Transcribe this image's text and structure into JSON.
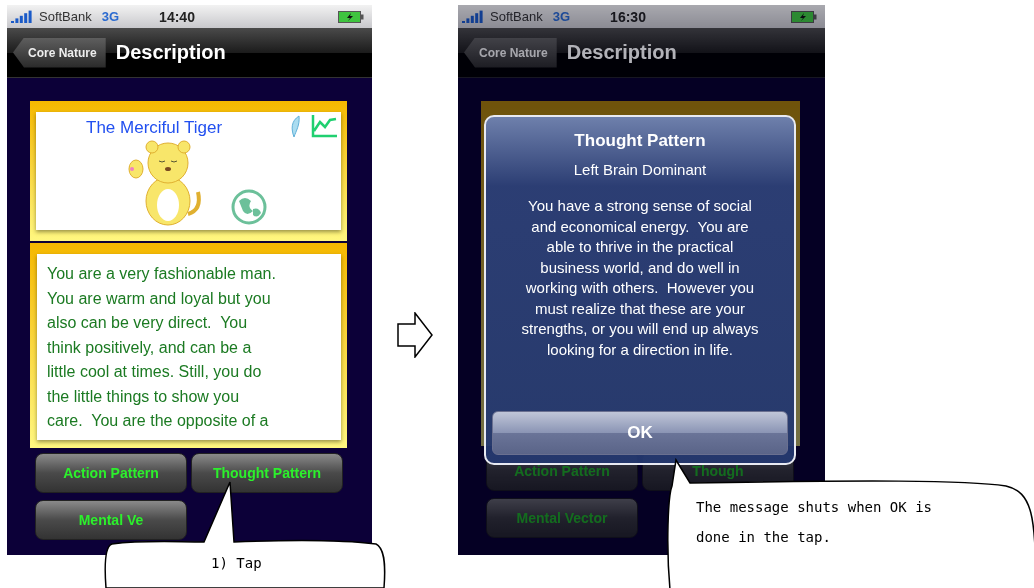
{
  "screens": [
    {
      "status": {
        "carrier": "SoftBank",
        "network": "3G",
        "time": "14:40"
      },
      "nav": {
        "back": "Core Nature",
        "title": "Description"
      },
      "dimmed": false,
      "card": {
        "title": "The Merciful Tiger"
      },
      "description": [
        "You are a very fashionable man.",
        "You are warm and loyal but you",
        "also can be very direct.  You",
        "think positively, and can be a",
        "little cool at times. Still, you do",
        "the little things to show you",
        "care.  You are the opposite of a"
      ],
      "buttons": [
        {
          "label": "Action Pattern"
        },
        {
          "label": "Thought Pattern"
        },
        {
          "label": "Mental Ve"
        }
      ]
    },
    {
      "status": {
        "carrier": "SoftBank",
        "network": "3G",
        "time": "16:30"
      },
      "nav": {
        "back": "Core Nature",
        "title": "Description"
      },
      "dimmed": true,
      "alert": {
        "title": "Thought Pattern",
        "subtitle": "Left Brain Dominant",
        "message": [
          "You have a strong sense of social",
          "and economical energy.  You are",
          "able to thrive in the practical",
          "business world, and do well in",
          "working with others.  However you",
          "must realize that these are your",
          "strengths, or you will end up always",
          "looking for a direction in life."
        ],
        "button": "OK"
      },
      "buttons": [
        {
          "label": "Action Pattern"
        },
        {
          "label": "Though"
        },
        {
          "label": "Mental Vector"
        }
      ]
    }
  ],
  "callouts": [
    {
      "text": "1) Tap"
    },
    {
      "text": "The message shuts when OK is done in the tap."
    }
  ]
}
